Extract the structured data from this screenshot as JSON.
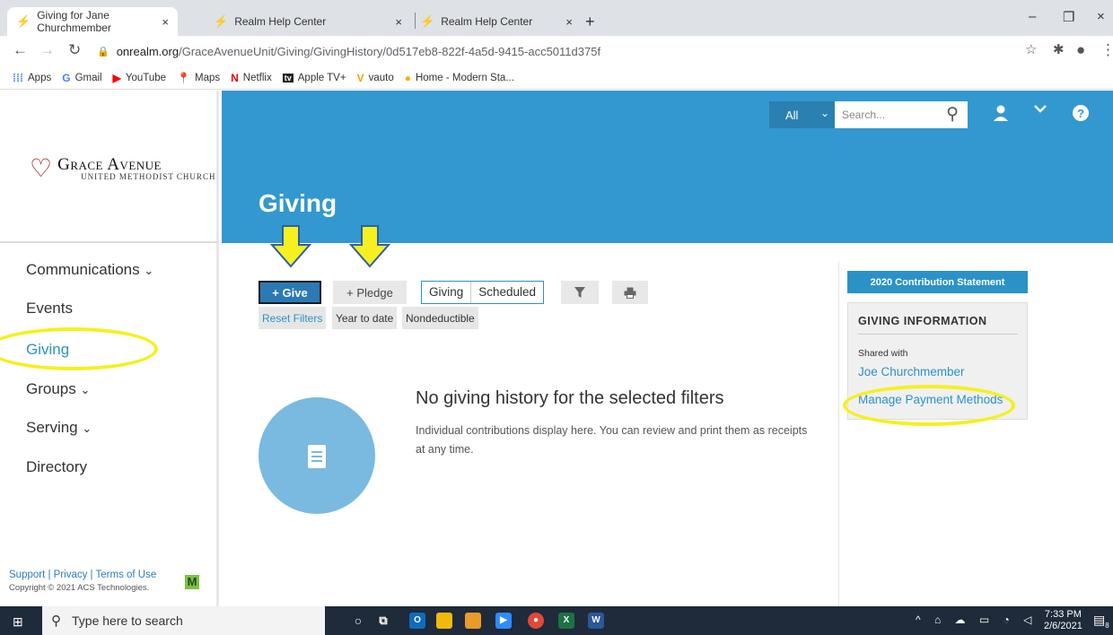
{
  "browser": {
    "tabs": [
      {
        "title": "Giving for Jane Churchmember",
        "close": "×"
      },
      {
        "title": "Realm Help Center",
        "close": "×"
      },
      {
        "title": "Realm Help Center",
        "close": "×"
      }
    ],
    "new_tab": "+",
    "window_controls": {
      "minimize": "–",
      "restore": "❐",
      "close": "×"
    },
    "url_host": "onrealm.org",
    "url_path": "/GraceAvenueUnit/Giving/GivingHistory/0d517eb8-822f-4a5d-9415-acc5011d375f",
    "bookmarks": [
      {
        "icon": "apps-icon",
        "label": "Apps",
        "color": "#4285f4"
      },
      {
        "icon": "gmail-icon",
        "label": "Gmail",
        "color": "#4285f4"
      },
      {
        "icon": "youtube-icon",
        "label": "YouTube",
        "color": "#ff0000"
      },
      {
        "icon": "maps-icon",
        "label": "Maps",
        "color": "#34a853"
      },
      {
        "icon": "netflix-icon",
        "label": "Netflix",
        "color": "#e50914"
      },
      {
        "icon": "appletv-icon",
        "label": "Apple TV+",
        "color": "#000000"
      },
      {
        "icon": "vauto-icon",
        "label": "vauto",
        "color": "#f0a30a"
      },
      {
        "icon": "home-icon",
        "label": "Home - Modern Sta...",
        "color": "#f5b400"
      }
    ]
  },
  "sidebar": {
    "logo_line1": "Grace Avenue",
    "logo_line2": "UNITED METHODIST CHURCH",
    "nav": [
      {
        "label": "Communications",
        "chevron": "⌄"
      },
      {
        "label": "Events",
        "chevron": ""
      },
      {
        "label": "Giving",
        "chevron": ""
      },
      {
        "label": "Groups",
        "chevron": "⌄"
      },
      {
        "label": "Serving",
        "chevron": "⌄"
      },
      {
        "label": "Directory",
        "chevron": ""
      }
    ],
    "active": "Giving",
    "footer_links": "Support | Privacy | Terms of Use",
    "copyright": "Copyright © 2021 ACS Technologies.",
    "ministry_logo": "M"
  },
  "header": {
    "page_title": "Giving",
    "scope_select": "All",
    "search_placeholder": "Search..."
  },
  "main": {
    "give_label": "+ Give",
    "pledge_label": "+ Pledge",
    "seg_giving": "Giving",
    "seg_scheduled": "Scheduled",
    "filters": [
      "Reset Filters",
      "Year to date",
      "Nondeductible"
    ],
    "empty_title": "No giving history for the selected filters",
    "empty_desc": "Individual contributions display here. You can review and print them as receipts at any time."
  },
  "rightpanel": {
    "statement_button": "2020 Contribution Statement",
    "info_heading": "GIVING INFORMATION",
    "shared_with_label": "Shared with",
    "shared_with_name": "Joe Churchmember",
    "manage_payment": "Manage Payment Methods"
  },
  "annotations": {
    "highlight_color": "#f5f01e"
  },
  "taskbar": {
    "search_placeholder": "Type here to search",
    "time": "7:33 PM",
    "date": "2/6/2021",
    "notifications": "8"
  }
}
